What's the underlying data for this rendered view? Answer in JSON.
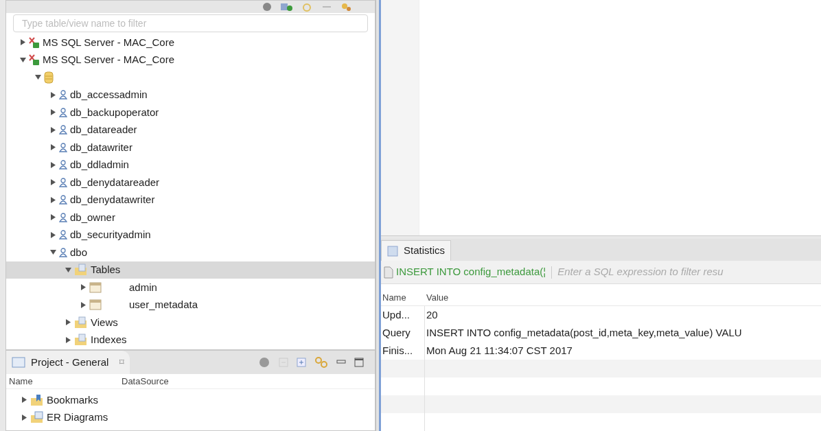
{
  "navigator": {
    "filter": {
      "placeholder": "Type table/view name to filter"
    },
    "tree": [
      {
        "kind": "connection",
        "label": "MS SQL Server - MAC_Core",
        "expanded": false,
        "selected": false
      },
      {
        "kind": "connection",
        "label": "MS SQL Server - MAC_Core",
        "expanded": true,
        "selected": false,
        "children": [
          {
            "kind": "database",
            "expanded": true,
            "selected": false,
            "children": [
              {
                "kind": "schema",
                "label": "db_accessadmin",
                "expanded": false,
                "selected": false
              },
              {
                "kind": "schema",
                "label": "db_backupoperator",
                "expanded": false,
                "selected": false
              },
              {
                "kind": "schema",
                "label": "db_datareader",
                "expanded": false,
                "selected": false
              },
              {
                "kind": "schema",
                "label": "db_datawriter",
                "expanded": false,
                "selected": false
              },
              {
                "kind": "schema",
                "label": "db_ddladmin",
                "expanded": false,
                "selected": false
              },
              {
                "kind": "schema",
                "label": "db_denydatareader",
                "expanded": false,
                "selected": false
              },
              {
                "kind": "schema",
                "label": "db_denydatawriter",
                "expanded": false,
                "selected": false
              },
              {
                "kind": "schema",
                "label": "db_owner",
                "expanded": false,
                "selected": false
              },
              {
                "kind": "schema",
                "label": "db_securityadmin",
                "expanded": false,
                "selected": false
              },
              {
                "kind": "schema",
                "label": "dbo",
                "expanded": true,
                "selected": false,
                "children": [
                  {
                    "kind": "folder",
                    "label": "Tables",
                    "expanded": true,
                    "selected": true,
                    "children": [
                      {
                        "kind": "table",
                        "label": "admin",
                        "expanded": false,
                        "selected": false
                      },
                      {
                        "kind": "table",
                        "label": "user_metadata",
                        "expanded": false,
                        "selected": false
                      }
                    ]
                  },
                  {
                    "kind": "folder",
                    "label": "Views",
                    "expanded": false,
                    "selected": false
                  },
                  {
                    "kind": "folder",
                    "label": "Indexes",
                    "expanded": false,
                    "selected": false
                  }
                ]
              }
            ]
          }
        ]
      }
    ]
  },
  "project": {
    "tab": "Project - General",
    "close": "⌑",
    "columns": [
      "Name",
      "DataSource"
    ],
    "items": [
      {
        "kind": "bookmarks",
        "label": "Bookmarks",
        "expanded": false
      },
      {
        "kind": "diagrams",
        "label": "ER Diagrams",
        "expanded": false
      }
    ]
  },
  "results": {
    "tab": "Statistics",
    "query": "INSERT INTO config_metadata(¦",
    "filter_placeholder": "Enter a SQL expression to filter resu",
    "columns": [
      "Name",
      "Value"
    ],
    "rows": [
      [
        "Upd...",
        "20"
      ],
      [
        "Query",
        "INSERT INTO config_metadata(post_id,meta_key,meta_value) VALU"
      ],
      [
        "Finis...",
        "Mon Aug 21 11:34:07 CST 2017"
      ]
    ]
  }
}
